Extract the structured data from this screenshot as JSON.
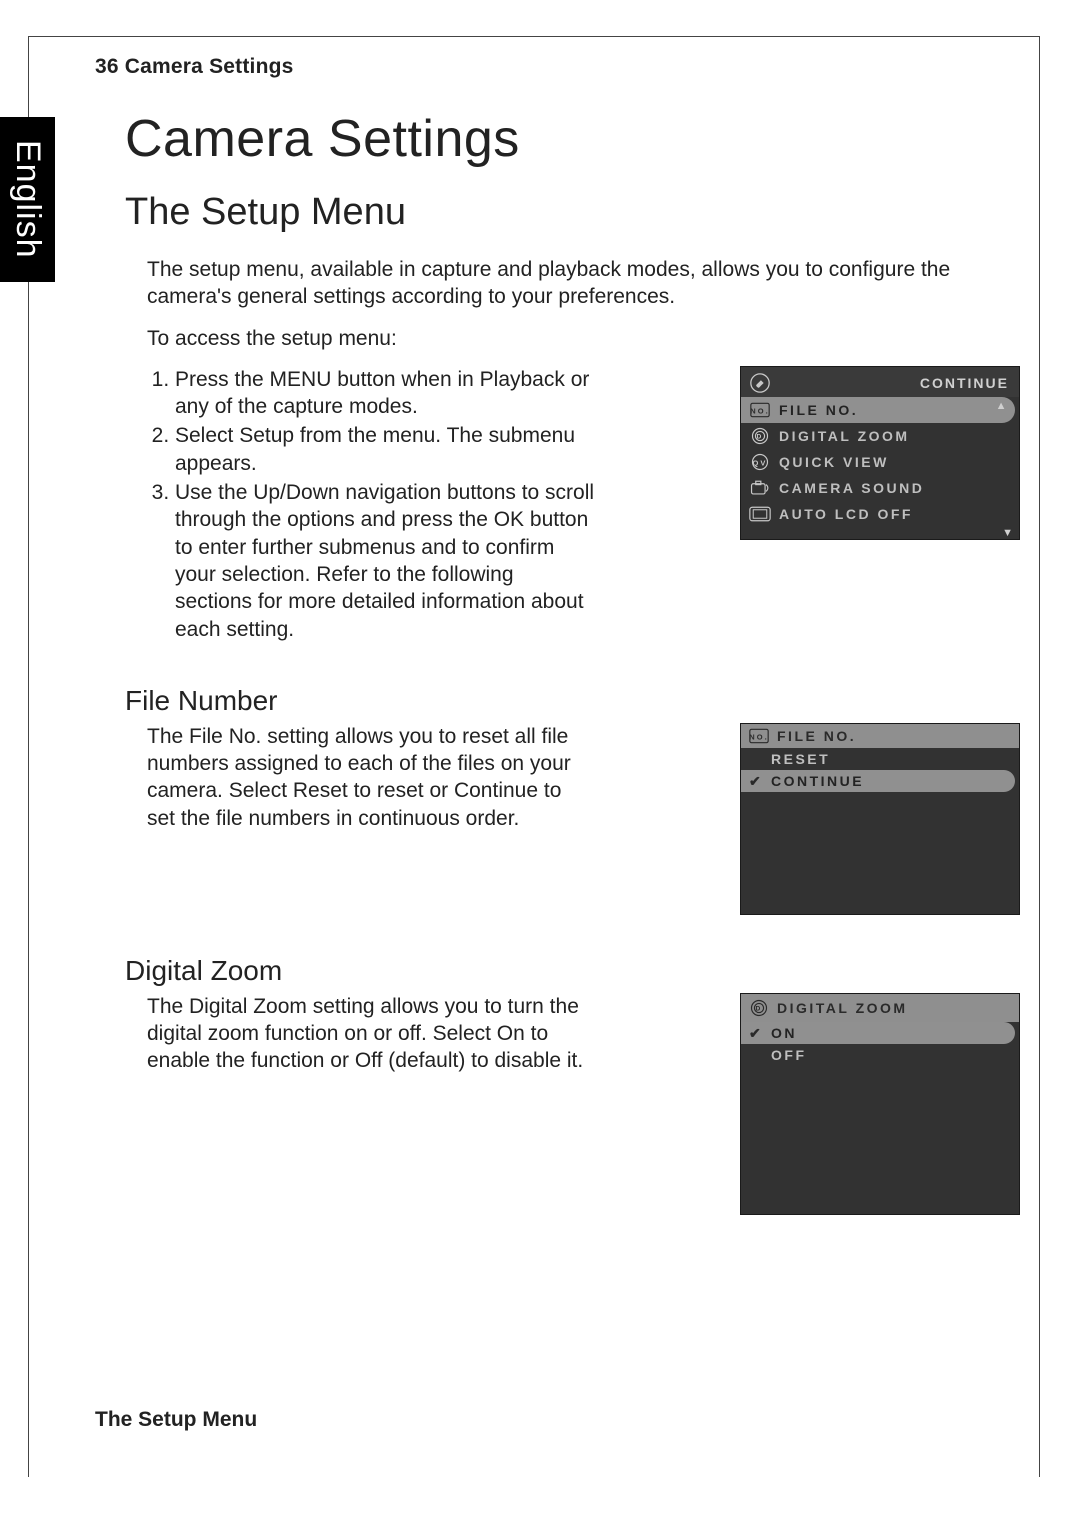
{
  "page": {
    "header": "36  Camera Settings",
    "side_tab": "English",
    "title": "Camera Settings",
    "section_h2": "The Setup Menu",
    "intro": "The setup menu, available in capture and playback modes, allows you to configure the camera's general settings according to your preferences.",
    "access_line": "To access the setup menu:",
    "steps": [
      "Press the MENU button when in Playback or any of the capture modes.",
      "Select Setup from the menu. The submenu appears.",
      "Use the Up/Down navigation buttons to scroll through the options and press the OK button to enter further submenus and to confirm your selection. Refer to the following sections for more detailed information about each setting."
    ],
    "file_number": {
      "heading": "File Number",
      "body": "The File No. setting allows you to reset all file numbers assigned to each of the files on your camera. Select Reset to reset or Continue to set the file numbers in continuous order."
    },
    "digital_zoom": {
      "heading": "Digital Zoom",
      "body": "The Digital Zoom setting allows you to turn the digital zoom function on or off. Select On to enable the function or Off (default) to disable it."
    },
    "footer": "The Setup Menu"
  },
  "menu1": {
    "header_right": "CONTINUE",
    "items": [
      {
        "label": "FILE NO.",
        "icon": "no-icon",
        "highlight": true
      },
      {
        "label": "DIGITAL ZOOM",
        "icon": "digital-zoom-icon",
        "highlight": false
      },
      {
        "label": "QUICK VIEW",
        "icon": "quick-view-icon",
        "highlight": false
      },
      {
        "label": "CAMERA SOUND",
        "icon": "camera-sound-icon",
        "highlight": false
      },
      {
        "label": "AUTO LCD OFF",
        "icon": "lcd-off-icon",
        "highlight": false
      }
    ]
  },
  "menu2": {
    "title": "FILE NO.",
    "title_icon": "no-icon",
    "options": [
      {
        "label": "RESET",
        "selected": false,
        "checked": false
      },
      {
        "label": "CONTINUE",
        "selected": true,
        "checked": true
      }
    ]
  },
  "menu3": {
    "title": "DIGITAL ZOOM",
    "title_icon": "digital-zoom-icon",
    "options": [
      {
        "label": "ON",
        "selected": true,
        "checked": true
      },
      {
        "label": "OFF",
        "selected": false,
        "checked": false
      }
    ]
  }
}
